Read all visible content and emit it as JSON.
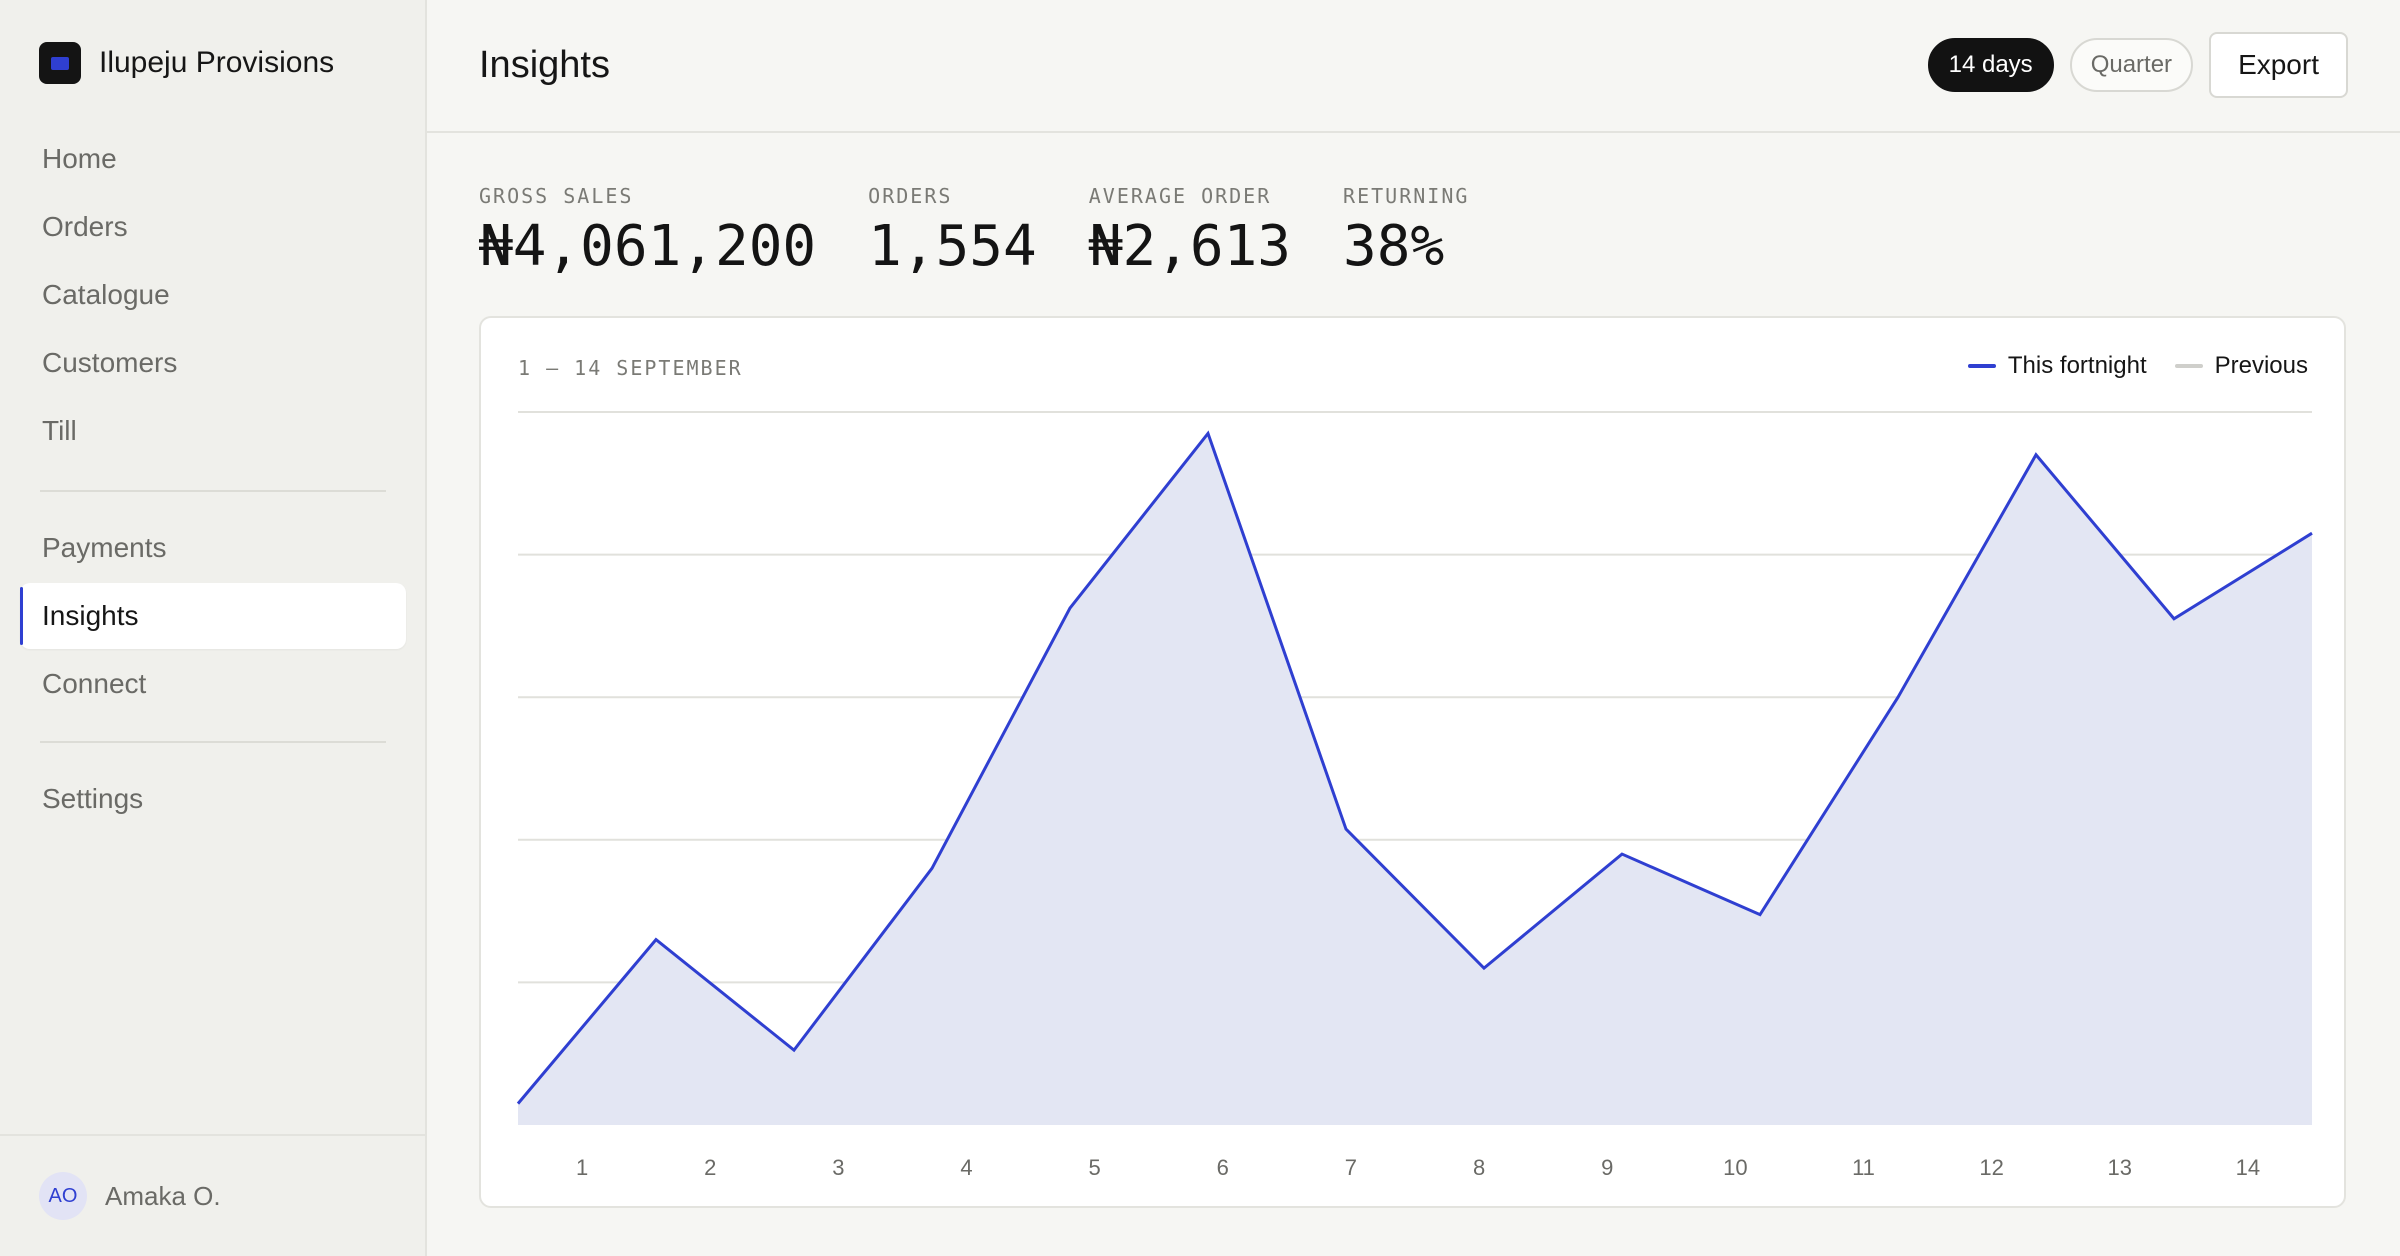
{
  "brand": {
    "name": "Ilupeju Provisions"
  },
  "sidebar": {
    "group1": [
      {
        "label": "Home"
      },
      {
        "label": "Orders"
      },
      {
        "label": "Catalogue"
      },
      {
        "label": "Customers"
      },
      {
        "label": "Till"
      }
    ],
    "group2": [
      {
        "label": "Payments"
      },
      {
        "label": "Insights",
        "active": true
      },
      {
        "label": "Connect"
      }
    ],
    "group3": [
      {
        "label": "Settings"
      }
    ]
  },
  "user": {
    "initials": "AO",
    "name": "Amaka O."
  },
  "header": {
    "title": "Insights",
    "range_options": [
      "14 days",
      "Quarter"
    ],
    "selected_range": "14 days",
    "export_label": "Export"
  },
  "kpis": [
    {
      "label": "GROSS SALES",
      "value": "₦4,061,200"
    },
    {
      "label": "ORDERS",
      "value": "1,554"
    },
    {
      "label": "AVERAGE ORDER",
      "value": "₦2,613"
    },
    {
      "label": "RETURNING",
      "value": "38%"
    }
  ],
  "chart_card": {
    "range_label": "1 – 14 SEPTEMBER"
  },
  "colors": {
    "accent": "#2f3fd1",
    "area_fill": "#e3e6f3",
    "previous": "#cfcfcb",
    "grid": "#e1e1dc"
  },
  "chart_data": {
    "type": "area",
    "x": [
      1,
      2,
      3,
      4,
      5,
      6,
      7,
      8,
      9,
      10,
      11,
      12,
      13,
      14
    ],
    "categories": [
      "1",
      "2",
      "3",
      "4",
      "5",
      "6",
      "7",
      "8",
      "9",
      "10",
      "11",
      "12",
      "13",
      "14"
    ],
    "series": [
      {
        "name": "This fortnight",
        "values": [
          3,
          26,
          10.5,
          36,
          72.5,
          97,
          41.5,
          22,
          38,
          29.5,
          60,
          94,
          71,
          83
        ]
      },
      {
        "name": "Previous",
        "values": []
      }
    ],
    "legend": "top-right",
    "ylim": [
      0,
      100
    ],
    "grid": true,
    "gridlines": 5,
    "y_axis_labels": false
  }
}
